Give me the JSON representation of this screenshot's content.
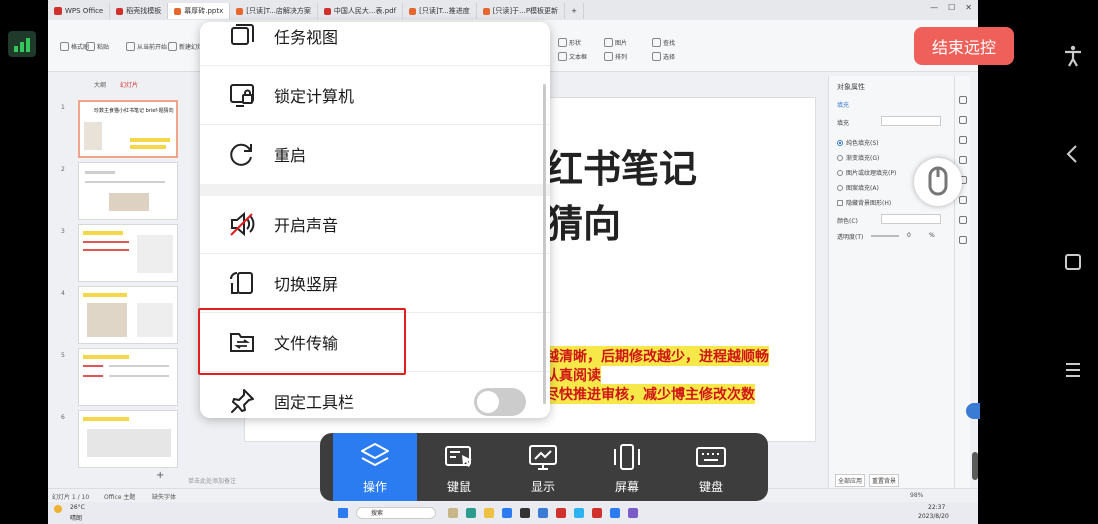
{
  "wps": {
    "tabs": [
      "WPS Office",
      "稻壳找模板",
      "幕厚砖.pptx",
      "[只读]T...店解决方案",
      "中国人民大...表.pdf",
      "[只读]T...推进度",
      "[只读]于...P模板更新"
    ],
    "ribbon": {
      "format_brush": "格式刷",
      "paste": "粘贴",
      "from_start": "从当前开始",
      "new_slide": "新建幻灯片",
      "shapes": "形状",
      "images": "图片",
      "find": "查找",
      "textbox": "文本框",
      "arrange": "排列",
      "select": "选择"
    },
    "left_panel": {
      "tab_outline": "大纲",
      "tab_slides": "幻灯片",
      "thumb1_title": "珍数主食猫小红书笔记 brief-题猜向",
      "slide_numbers": [
        "1",
        "2",
        "3",
        "4",
        "5",
        "6"
      ]
    },
    "slide": {
      "title_line1": "红书笔记",
      "title_line2": "猜向",
      "line1": "越清晰，后期修改越少，进程越顺畅",
      "line2": "认真阅读",
      "line3": "尽快推进审核，减少博主修改次数"
    },
    "right_panel": {
      "title": "对象属性",
      "fill_tab": "填充",
      "fill_label": "填充",
      "options": [
        "纯色填充(S)",
        "渐变填充(G)",
        "图片或纹理填充(P)",
        "图案填充(A)",
        "隐藏背景图形(H)"
      ],
      "color_label": "颜色(C)",
      "transparency_label": "透明度(T)",
      "transparency_value": "0",
      "percent": "%",
      "apply_all": "全部应用",
      "reset_bg": "重置背景"
    },
    "statusbar": {
      "slide_info": "幻灯片 1 / 10",
      "theme": "Office 主题",
      "font_missing": "缺失字体",
      "notes_hint": "单击此处添加备注",
      "zoom": "98%"
    },
    "taskbar": {
      "weather_temp": "26°C",
      "weather_desc": "晴朗",
      "search": "搜索",
      "time": "22:37",
      "date": "2023/8/20"
    }
  },
  "menu": {
    "items": [
      {
        "label": "任务视图",
        "icon": "task-view-icon"
      },
      {
        "label": "锁定计算机",
        "icon": "lock-computer-icon"
      },
      {
        "label": "重启",
        "icon": "restart-icon"
      },
      {
        "label": "开启声音",
        "icon": "sound-off-icon"
      },
      {
        "label": "切换竖屏",
        "icon": "rotate-screen-icon"
      },
      {
        "label": "文件传输",
        "icon": "file-transfer-icon"
      },
      {
        "label": "固定工具栏",
        "icon": "pin-icon"
      }
    ],
    "pin_toolbar_enabled": false
  },
  "toolbar": {
    "buttons": [
      {
        "label": "操作",
        "active": true
      },
      {
        "label": "键鼠",
        "active": false
      },
      {
        "label": "显示",
        "active": false
      },
      {
        "label": "屏幕",
        "active": false
      },
      {
        "label": "键盘",
        "active": false
      }
    ]
  },
  "end_remote_label": "结束远控",
  "colors": {
    "accent_blue": "#2b7cf0",
    "end_button": "#f0605a",
    "toolbar_bg": "#3d3d3d",
    "highlight_red": "#e02020",
    "signal_green": "#34c759"
  }
}
